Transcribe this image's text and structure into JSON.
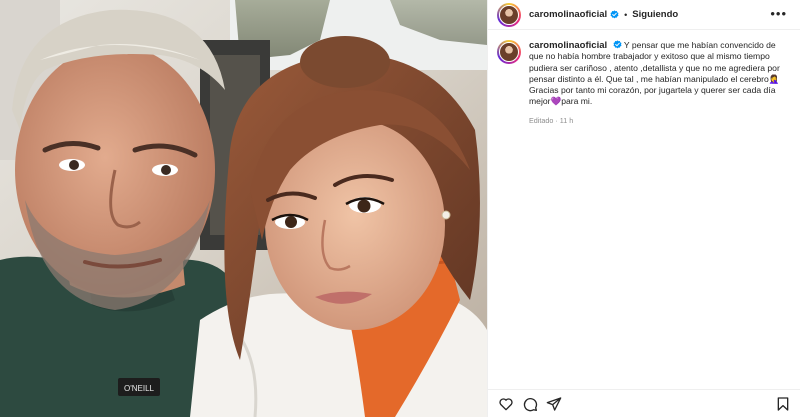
{
  "header": {
    "username": "caromolinaoficial",
    "separator": "•",
    "follow_state": "Siguiendo",
    "more_icon": "more-horizontal-icon"
  },
  "caption": {
    "username": "caromolinaoficial",
    "text_line1": "Y pensar que me habían convencido de que no había hombre trabajador y exitoso que al mismo tiempo pudiera ser cariñoso , atento ,detallista y que no me agrediera por pensar distinto a él. Que tal , me habían manipulado el cerebro🤦‍♀️",
    "text_line2": "Gracias por tanto mi corazón, por jugartela y querer ser cada día mejor💜para mi.",
    "edited": "Editado",
    "dot": "·",
    "time": "11 h"
  },
  "actions": {
    "like_icon": "heart-icon",
    "comment_icon": "comment-icon",
    "share_icon": "share-icon",
    "save_icon": "bookmark-icon"
  },
  "photo": {
    "shirt_brand": "O'NEILL"
  },
  "colors": {
    "verified": "#0095f6",
    "border": "#efefef",
    "muted": "#8e8e8e"
  }
}
